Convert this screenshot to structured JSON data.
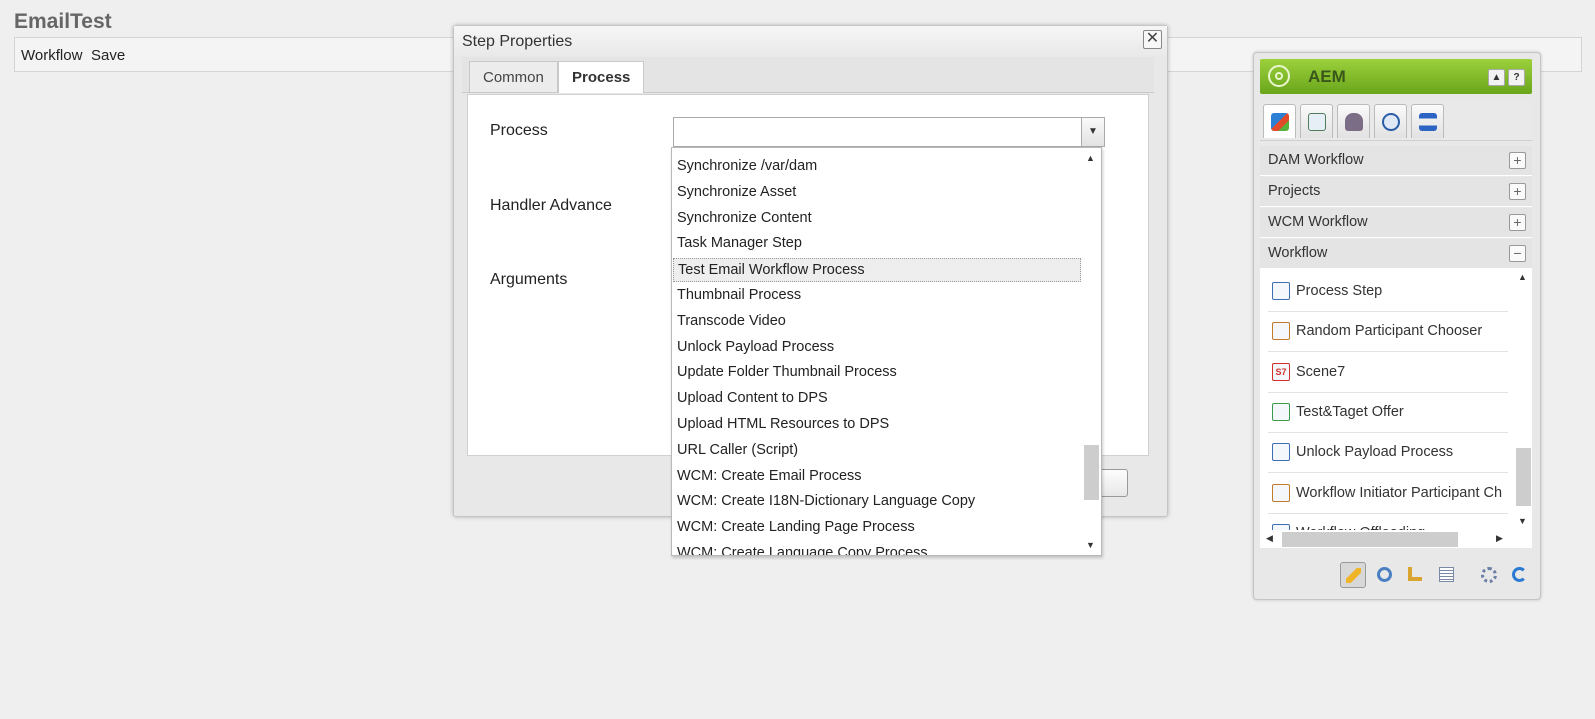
{
  "page": {
    "title": "EmailTest"
  },
  "toolbar": {
    "workflow_label": "Workflow",
    "save_label": "Save"
  },
  "dialog": {
    "title": "Step Properties",
    "close_glyph": "✕",
    "tabs": [
      {
        "label": "Common",
        "active": false
      },
      {
        "label": "Process",
        "active": true
      }
    ],
    "fields": {
      "process_label": "Process",
      "process_value": "",
      "handler_label": "Handler Advance",
      "arguments_label": "Arguments"
    },
    "footer_button_label": ""
  },
  "dropdown": {
    "highlighted_index": 4,
    "items": [
      "Synchronize /var/dam",
      "Synchronize Asset",
      "Synchronize Content",
      "Task Manager Step",
      "Test Email Workflow Process",
      "Thumbnail Process",
      "Transcode Video",
      "Unlock Payload Process",
      "Update Folder Thumbnail Process",
      "Upload Content to DPS",
      "Upload HTML Resources to DPS",
      "URL Caller (Script)",
      "WCM: Create Email Process",
      "WCM: Create I18N-Dictionary Language Copy",
      "WCM: Create Landing Page Process",
      "WCM: Create Language Copy Process"
    ]
  },
  "sidekick": {
    "title": "AEM",
    "collapse_glyph": "▲",
    "help_glyph": "?",
    "tab_icons": [
      "components-icon",
      "page-icon",
      "lock-icon",
      "versioning-icon",
      "workflow-icon"
    ],
    "categories": [
      {
        "label": "DAM Workflow",
        "toggle": "+"
      },
      {
        "label": "Projects",
        "toggle": "+"
      },
      {
        "label": "WCM Workflow",
        "toggle": "+"
      },
      {
        "label": "Workflow",
        "toggle": "−"
      }
    ],
    "components": [
      {
        "label": "Process Step",
        "icon": "process-step-icon",
        "glyph": ""
      },
      {
        "label": "Random Participant Chooser",
        "icon": "participant-icon",
        "glyph": ""
      },
      {
        "label": "Scene7",
        "icon": "scene7-icon",
        "glyph": "S7"
      },
      {
        "label": "Test&Taget Offer",
        "icon": "target-offer-icon",
        "glyph": ""
      },
      {
        "label": "Unlock Payload Process",
        "icon": "process-step-icon",
        "glyph": ""
      },
      {
        "label": "Workflow Initiator Participant Ch",
        "icon": "participant-icon",
        "glyph": ""
      },
      {
        "label": "Workflow Offloading",
        "icon": "process-step-icon",
        "glyph": ""
      }
    ],
    "bottom_icons": [
      "edit-pencil-icon",
      "search-magnifier-icon",
      "ruler-icon",
      "properties-icon",
      "settings-gears-icon",
      "refresh-icon"
    ]
  }
}
